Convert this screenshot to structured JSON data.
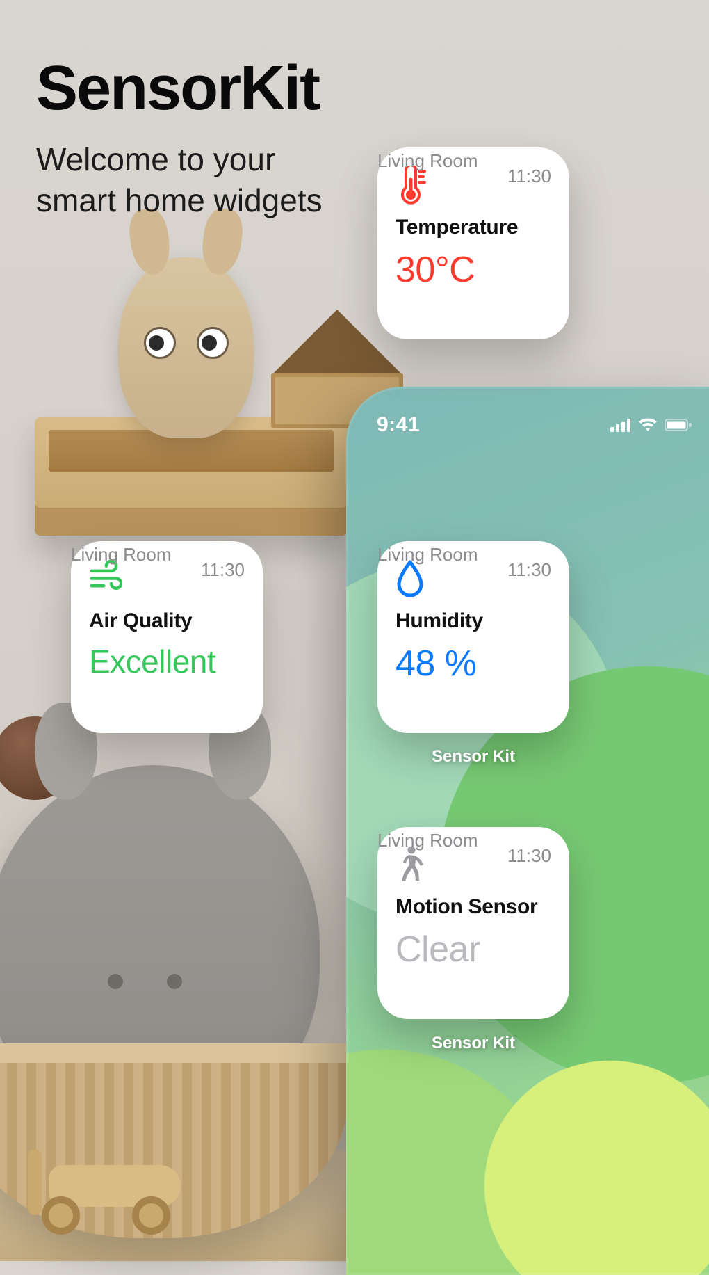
{
  "hero": {
    "title": "SensorKit",
    "subtitle_line1": "Welcome to your",
    "subtitle_line2": "smart home widgets"
  },
  "phone": {
    "time": "9:41",
    "widget_caption": "Sensor Kit"
  },
  "widgets": {
    "temperature": {
      "icon": "thermometer-icon",
      "icon_color": "#ff3b30",
      "time": "11:30",
      "title": "Temperature",
      "room": "Living Room",
      "value": "30°C",
      "value_color": "#ff3b30"
    },
    "air_quality": {
      "icon": "wind-icon",
      "icon_color": "#34c759",
      "time": "11:30",
      "title": "Air Quality",
      "room": "Living Room",
      "value": "Excellent",
      "value_color": "#34c759"
    },
    "humidity": {
      "icon": "drop-icon",
      "icon_color": "#0a7aff",
      "time": "11:30",
      "title": "Humidity",
      "room": "Living Room",
      "value": "48 %",
      "value_color": "#0a7aff"
    },
    "motion": {
      "icon": "walking-icon",
      "icon_color": "#9b9ba0",
      "time": "11:30",
      "title": "Motion Sensor",
      "room": "Living Room",
      "value": "Clear",
      "value_color": "#b9b9be"
    }
  }
}
